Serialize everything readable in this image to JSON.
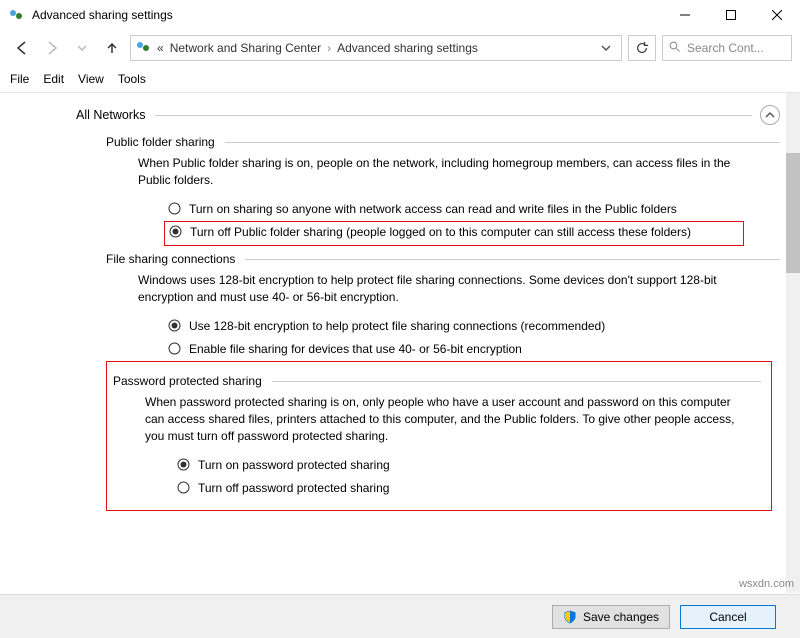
{
  "window": {
    "title": "Advanced sharing settings"
  },
  "breadcrumb": {
    "item1": "Network and Sharing Center",
    "item2": "Advanced sharing settings"
  },
  "search": {
    "placeholder": "Search Cont..."
  },
  "menu": {
    "file": "File",
    "edit": "Edit",
    "view": "View",
    "tools": "Tools"
  },
  "section": {
    "all_networks": "All Networks"
  },
  "pfs": {
    "header": "Public folder sharing",
    "desc": "When Public folder sharing is on, people on the network, including homegroup members, can access files in the Public folders.",
    "opt_on": "Turn on sharing so anyone with network access can read and write files in the Public folders",
    "opt_off": "Turn off Public folder sharing (people logged on to this computer can still access these folders)"
  },
  "fsc": {
    "header": "File sharing connections",
    "desc": "Windows uses 128-bit encryption to help protect file sharing connections. Some devices don't support 128-bit encryption and must use 40- or 56-bit encryption.",
    "opt_128": "Use 128-bit encryption to help protect file sharing connections (recommended)",
    "opt_40": "Enable file sharing for devices that use 40- or 56-bit encryption"
  },
  "pps": {
    "header": "Password protected sharing",
    "desc": "When password protected sharing is on, only people who have a user account and password on this computer can access shared files, printers attached to this computer, and the Public folders. To give other people access, you must turn off password protected sharing.",
    "opt_on": "Turn on password protected sharing",
    "opt_off": "Turn off password protected sharing"
  },
  "buttons": {
    "save": "Save changes",
    "cancel": "Cancel"
  },
  "watermark": "wsxdn.com"
}
